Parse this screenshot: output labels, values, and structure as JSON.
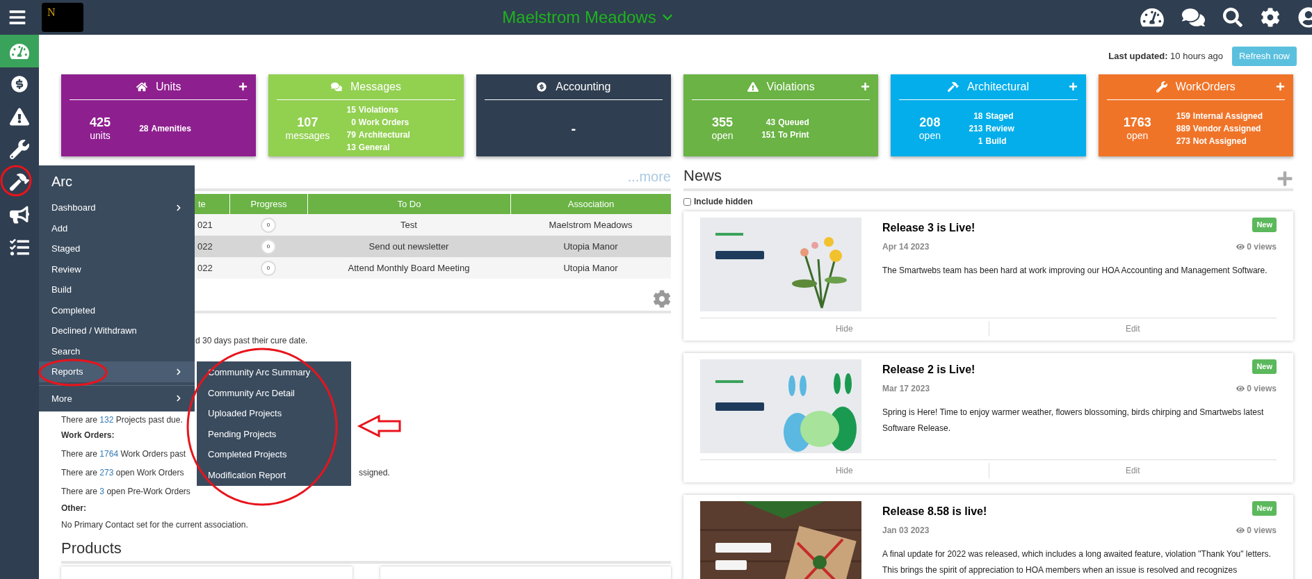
{
  "top_bar": {
    "logo": "N",
    "title": "Maelstrom Meadows"
  },
  "sidebar": {
    "items": [
      {
        "selected": true
      },
      {
        "selected": false
      },
      {
        "selected": false
      },
      {
        "selected": false
      },
      {
        "selected": false
      },
      {
        "selected": false
      },
      {
        "selected": false
      }
    ]
  },
  "last_updated": {
    "text": "**Last updated:** 10 hours ago",
    "button": "Refresh now"
  },
  "tiles": [
    {
      "kind": "stat",
      "title": "Units",
      "color": "#8e1f8f",
      "add": true,
      "count": "425",
      "unit": "units",
      "details": [
        {
          "count": "28",
          "label": "Amenities"
        }
      ]
    },
    {
      "kind": "stat",
      "title": "Messages",
      "color": "#92d050",
      "add": false,
      "count": "107",
      "unit": "messages",
      "details": [
        {
          "count": "15",
          "label": "Violations"
        },
        {
          "count": "0",
          "label": "Work Orders"
        },
        {
          "count": "79",
          "label": "Architectural"
        },
        {
          "count": "13",
          "label": "General"
        }
      ]
    },
    {
      "kind": "dash",
      "title": "Accounting",
      "color": "#2f3e50",
      "add": false,
      "value": "-"
    },
    {
      "kind": "stat",
      "title": "Violations",
      "color": "#6ab344",
      "add": true,
      "count": "355",
      "unit": "open",
      "details": [
        {
          "count": "43",
          "label": "Queued"
        },
        {
          "count": "151",
          "label": "To Print"
        }
      ]
    },
    {
      "kind": "stat",
      "title": "Architectural",
      "color": "#03aeea",
      "add": true,
      "count": "208",
      "unit": "open",
      "details": [
        {
          "count": "18",
          "label": "Staged"
        },
        {
          "count": "213",
          "label": "Review"
        },
        {
          "count": "1",
          "label": "Build"
        }
      ]
    },
    {
      "kind": "stat",
      "title": "WorkOrders",
      "color": "#f07428",
      "add": true,
      "count": "1763",
      "unit": "open",
      "details": [
        {
          "count": "159",
          "label": "Internal Assigned"
        },
        {
          "count": "889",
          "label": "Vendor Assigned"
        },
        {
          "count": "273",
          "label": "Not Assigned"
        }
      ]
    }
  ],
  "tasks": {
    "more": "...more",
    "columns": [
      "te",
      "Progress",
      "To Do",
      "Association"
    ],
    "rows": [
      {
        "selected": false,
        "date": "021",
        "progress": "0",
        "todo": "Test",
        "association": "Maelstrom Meadows"
      },
      {
        "selected": true,
        "date": "022",
        "progress": "0",
        "todo": "Send out newsletter",
        "association": "Utopia Manor"
      },
      {
        "selected": false,
        "date": "022",
        "progress": "0",
        "todo": "Attend Monthly Board Meeting",
        "association": "Utopia Manor"
      }
    ]
  },
  "summary": {
    "fragment": "d 30 days past their cure date.",
    "projects_line": "There are **132** Projects past due.",
    "work_orders": {
      "heading": "Work Orders:",
      "lines": [
        {
          "text": "There are **1764** Work Orders past"
        },
        {
          "text": "There are **273** open Work Orders",
          "tail": "ssigned."
        },
        {
          "text": "There are **3** open Pre-Work Orders"
        }
      ]
    },
    "other": {
      "heading": "Other:",
      "text": "No Primary Contact set for the current association."
    }
  },
  "products": {
    "title": "Products"
  },
  "arc_menu": {
    "title": "Arc",
    "items": [
      {
        "label": "Dashboard",
        "submenu": true,
        "selected": false
      },
      {
        "label": "Add",
        "submenu": false,
        "selected": false
      },
      {
        "label": "Staged",
        "submenu": false,
        "selected": false
      },
      {
        "label": "Review",
        "submenu": false,
        "selected": false
      },
      {
        "label": "Build",
        "submenu": false,
        "selected": false
      },
      {
        "label": "Completed",
        "submenu": false,
        "selected": false
      },
      {
        "label": "Declined / Withdrawn",
        "submenu": false,
        "selected": false
      },
      {
        "label": "Search",
        "submenu": false,
        "selected": false
      },
      {
        "label": "Reports",
        "submenu": true,
        "selected": true
      },
      {
        "label": "More",
        "submenu": true,
        "selected": false
      }
    ]
  },
  "reports_menu": {
    "items": [
      "Community Arc Summary",
      "Community Arc Detail",
      "Uploaded Projects",
      "Pending Projects",
      "Completed Projects",
      "Modification Report"
    ]
  },
  "news": {
    "title": "News",
    "include_hidden": {
      "label": "Include hidden",
      "checked": false
    },
    "items": [
      {
        "title": "Release 3 is Live!",
        "date": "Apr 14 2023",
        "views": "0 views",
        "badge": "New",
        "body": "The Smartwebs team has been hard at work improving our HOA Accounting and Management Software.",
        "actions": [
          "Hide",
          "Edit"
        ]
      },
      {
        "title": "Release 2 is Live!",
        "date": "Mar 17 2023",
        "views": "0 views",
        "badge": "New",
        "body": "Spring is Here! Time to enjoy warmer weather, flowers blossoming, birds chirping and Smartwebs latest Software Release.",
        "actions": [
          "Hide",
          "Edit"
        ]
      },
      {
        "title": "Release 8.58 is live!",
        "date": "Jan 03 2023",
        "views": "0 views",
        "badge": "New",
        "body": "A final update for 2022 was released, which includes a long awaited feature, violation \"Thank You\" letters. This brings the spirit of appreciation to HOA members when an issue is resolved and recognizes"
      }
    ]
  }
}
